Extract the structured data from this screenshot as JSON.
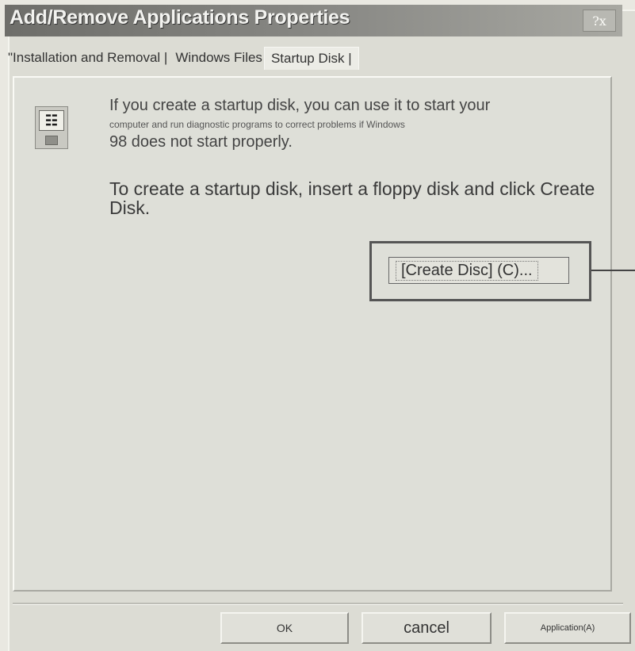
{
  "window": {
    "title": "Add/Remove Applications Properties",
    "help_label": "?x"
  },
  "tabs": {
    "install_label": "\"Installation and Removal |",
    "windows_files_label": "Windows Files",
    "startup_disk_label": "Startup Disk |"
  },
  "content": {
    "line1": "If you create a startup disk, you can use it to start your",
    "line2": "computer and run diagnostic programs to correct problems if Windows",
    "line3": "98 does not start properly.",
    "instruction": "To create a startup disk, insert a floppy disk and click Create Disk."
  },
  "create_button": {
    "label": "[Create Disc] (C)..."
  },
  "footer": {
    "ok_label": "OK",
    "cancel_label": "cancel",
    "apply_label": "Application(A)"
  },
  "colors": {
    "title_bar": "#7a7a76",
    "dialog_bg": "#dcdcd4"
  },
  "icons": {
    "disk_icon": "floppy-disk-icon"
  }
}
